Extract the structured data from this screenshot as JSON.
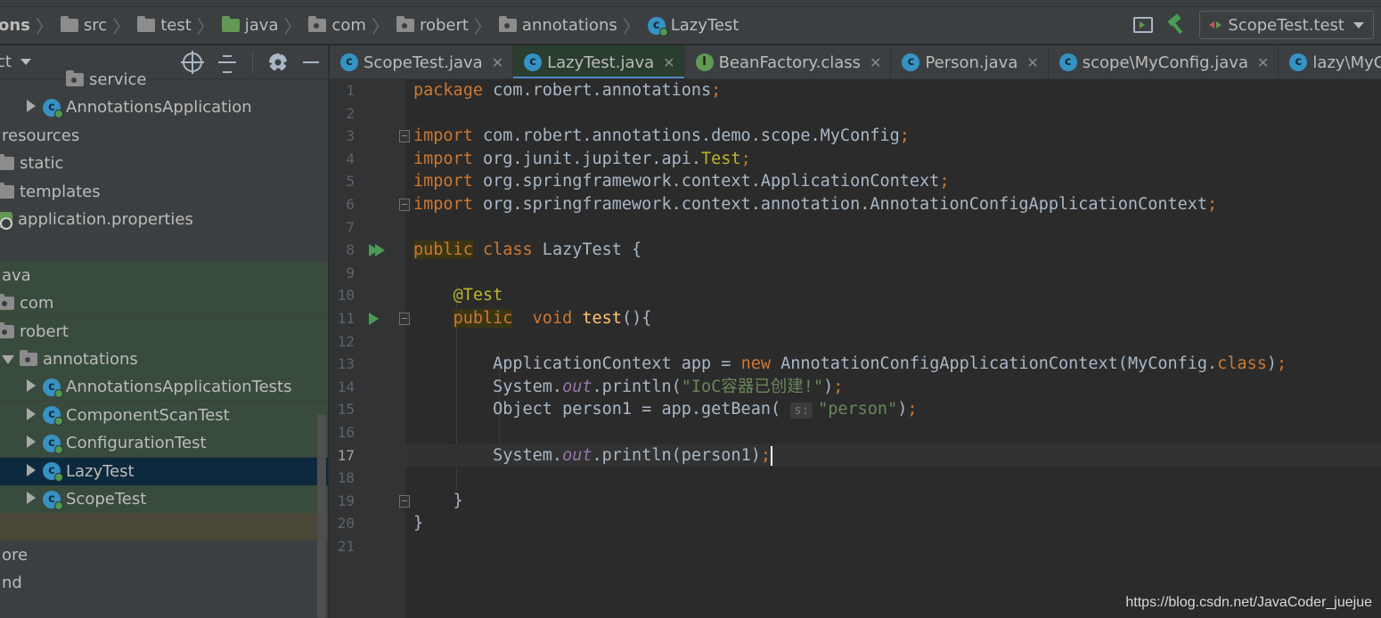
{
  "breadcrumbs": [
    {
      "label": "ons",
      "icon": "none"
    },
    {
      "label": "src",
      "icon": "folder-icon"
    },
    {
      "label": "test",
      "icon": "folder-icon"
    },
    {
      "label": "java",
      "icon": "green-folder-icon"
    },
    {
      "label": "com",
      "icon": "package-icon"
    },
    {
      "label": "robert",
      "icon": "package-icon"
    },
    {
      "label": "annotations",
      "icon": "package-icon"
    },
    {
      "label": "LazyTest",
      "icon": "test-class-icon"
    }
  ],
  "run_config": {
    "label": "ScopeTest.test"
  },
  "project_panel": {
    "title": "ct",
    "tree": [
      {
        "label": "service",
        "indent": 3,
        "icon": "package"
      },
      {
        "label": "AnnotationsApplication",
        "indent": 2,
        "icon": "class",
        "toggle": "right"
      },
      {
        "label": "resources",
        "indent": 0,
        "icon": "none"
      },
      {
        "label": "static",
        "indent": 0,
        "icon": "folder"
      },
      {
        "label": "templates",
        "indent": 0,
        "icon": "folder"
      },
      {
        "label": "application.properties",
        "indent": 0,
        "icon": "props"
      },
      {
        "label": "",
        "indent": 0,
        "icon": "none"
      },
      {
        "label": "ava",
        "indent": 0,
        "icon": "none",
        "bg": "green"
      },
      {
        "label": "com",
        "indent": 0,
        "icon": "package",
        "bg": "green"
      },
      {
        "label": "robert",
        "indent": 0,
        "icon": "package",
        "bg": "green",
        "toggle": "down"
      },
      {
        "label": "annotations",
        "indent": 1,
        "icon": "package",
        "bg": "green",
        "toggle": "down"
      },
      {
        "label": "AnnotationsApplicationTests",
        "indent": 2,
        "icon": "class",
        "bg": "green",
        "toggle": "right"
      },
      {
        "label": "ComponentScanTest",
        "indent": 2,
        "icon": "class",
        "bg": "green",
        "toggle": "right"
      },
      {
        "label": "ConfigurationTest",
        "indent": 2,
        "icon": "class",
        "bg": "green",
        "toggle": "right"
      },
      {
        "label": "LazyTest",
        "indent": 2,
        "icon": "class",
        "bg": "selected",
        "toggle": "right"
      },
      {
        "label": "ScopeTest",
        "indent": 2,
        "icon": "class",
        "bg": "green",
        "toggle": "right"
      },
      {
        "label": "",
        "indent": 0,
        "icon": "none",
        "bg": "olive"
      },
      {
        "label": "ore",
        "indent": 0,
        "icon": "none"
      },
      {
        "label": "nd",
        "indent": 0,
        "icon": "none"
      }
    ]
  },
  "tabs": [
    {
      "label": "ScopeTest.java",
      "icon": "class",
      "active": false
    },
    {
      "label": "LazyTest.java",
      "icon": "class",
      "active": true
    },
    {
      "label": "BeanFactory.class",
      "icon": "interface",
      "active": false
    },
    {
      "label": "Person.java",
      "icon": "class",
      "active": false
    },
    {
      "label": "scope\\MyConfig.java",
      "icon": "class",
      "active": false
    },
    {
      "label": "lazy\\MyCon",
      "icon": "class",
      "active": false
    }
  ],
  "code": {
    "line_numbers": [
      "1",
      "2",
      "3",
      "4",
      "5",
      "6",
      "7",
      "8",
      "9",
      "10",
      "11",
      "12",
      "13",
      "14",
      "15",
      "16",
      "17",
      "18",
      "19",
      "20",
      "21"
    ],
    "current_line": "17",
    "lines": [
      "package com.robert.annotations;",
      "",
      "import com.robert.annotations.demo.scope.MyConfig;",
      "import org.junit.jupiter.api.Test;",
      "import org.springframework.context.ApplicationContext;",
      "import org.springframework.context.annotation.AnnotationConfigApplicationContext;",
      "",
      "public class LazyTest {",
      "",
      "    @Test",
      "    public  void test(){",
      "",
      "        ApplicationContext app = new AnnotationConfigApplicationContext(MyConfig.class);",
      "        System.out.println(\"IoC容器已创建!\");",
      "        Object person1 = app.getBean( s: \"person\");",
      "",
      "        System.out.println(person1);",
      "",
      "    }",
      "}",
      ""
    ],
    "param_hint": "s:"
  },
  "watermark": "https://blog.csdn.net/JavaCoder_juejue"
}
